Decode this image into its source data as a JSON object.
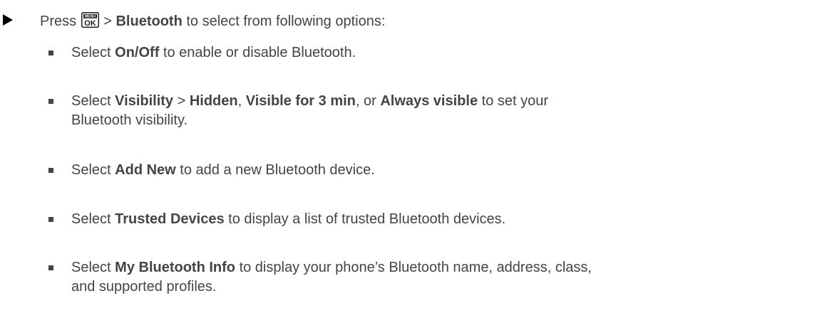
{
  "step": {
    "prefix": "Press ",
    "icon": "menu-ok-key-icon",
    "icon_top_label": "MENU",
    "icon_bottom_label": "OK",
    "between": " > ",
    "bold": "Bluetooth",
    "suffix": " to select from following options:"
  },
  "items": [
    {
      "parts": [
        {
          "text": "Select ",
          "bold": false
        },
        {
          "text": "On/Off",
          "bold": true
        },
        {
          "text": " to enable or disable Bluetooth.",
          "bold": false
        }
      ]
    },
    {
      "parts": [
        {
          "text": "Select ",
          "bold": false
        },
        {
          "text": "Visibility",
          "bold": true
        },
        {
          "text": " > ",
          "bold": false
        },
        {
          "text": "Hidden",
          "bold": true
        },
        {
          "text": ", ",
          "bold": false
        },
        {
          "text": "Visible for 3 min",
          "bold": true
        },
        {
          "text": ", or ",
          "bold": false
        },
        {
          "text": "Always visible",
          "bold": true
        },
        {
          "text": " to set your",
          "bold": false
        },
        {
          "text": "Bluetooth visibility.",
          "bold": false,
          "newline": true
        }
      ]
    },
    {
      "parts": [
        {
          "text": "Select ",
          "bold": false
        },
        {
          "text": "Add New",
          "bold": true
        },
        {
          "text": " to add a new Bluetooth device.",
          "bold": false
        }
      ]
    },
    {
      "parts": [
        {
          "text": "Select ",
          "bold": false
        },
        {
          "text": "Trusted Devices",
          "bold": true
        },
        {
          "text": " to display a list of trusted Bluetooth devices.",
          "bold": false
        }
      ]
    },
    {
      "parts": [
        {
          "text": "Select ",
          "bold": false
        },
        {
          "text": "My Bluetooth Info",
          "bold": true
        },
        {
          "text": " to display your phone’s Bluetooth name, address, class,",
          "bold": false
        },
        {
          "text": "and supported profiles.",
          "bold": false,
          "newline": true
        }
      ]
    }
  ]
}
